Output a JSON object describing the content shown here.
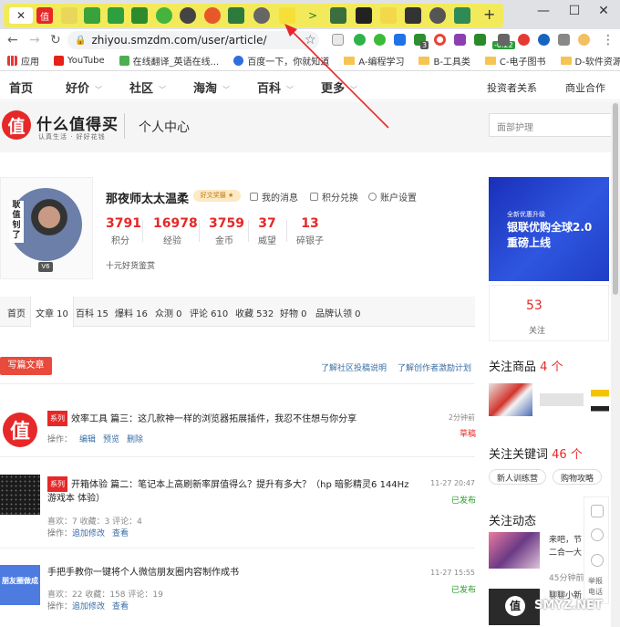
{
  "browser": {
    "tab_glyph": "✕",
    "new_tab": "+",
    "window_min": "—",
    "window_max": "☐",
    "window_close": "✕",
    "url": "zhiyou.smzdm.com/user/article/",
    "ext_badges": [
      "3",
      "-0.22"
    ]
  },
  "bookmarks": [
    {
      "label": "应用",
      "kind": "apps"
    },
    {
      "label": "YouTube",
      "kind": "youtube"
    },
    {
      "label": "在线翻译_英语在线...",
      "kind": "green"
    },
    {
      "label": "百度一下，你就知道",
      "kind": "paw"
    },
    {
      "label": "A-编程学习",
      "kind": "folder"
    },
    {
      "label": "B-工具类",
      "kind": "folder"
    },
    {
      "label": "C-电子图书",
      "kind": "folder"
    },
    {
      "label": "D-软件资源",
      "kind": "folder"
    }
  ],
  "sitenav": {
    "items": [
      "首页",
      "好价",
      "社区",
      "海淘",
      "百科",
      "更多"
    ],
    "right": [
      "投资者关系",
      "商业合作"
    ]
  },
  "header": {
    "logo_char": "值",
    "logo_text": "什么值得买",
    "slogan": "认真生活 · 好好花钱",
    "title": "个人中心",
    "search_placeholder": "面部护理"
  },
  "profile": {
    "avatar_text": "耿值钊了",
    "level": "V6",
    "username": "那夜师太太温柔",
    "badge": "好文奖摄 ★",
    "links": [
      "我的消息",
      "积分兑换",
      "账户设置"
    ],
    "stats": [
      {
        "value": "3791",
        "label": "积分"
      },
      {
        "value": "16978",
        "label": "经验"
      },
      {
        "value": "3759",
        "label": "金币"
      },
      {
        "value": "37",
        "label": "威望"
      },
      {
        "value": "13",
        "label": "碎银子"
      }
    ],
    "subtitle": "十元好货鉴赏"
  },
  "content_tabs": [
    "首页",
    "文章 10",
    "百科 15",
    "爆料 16",
    "众测 0",
    "评论 610",
    "收藏 532",
    "好物 0",
    "品牌认领 0"
  ],
  "actions": {
    "write": "写篇文章",
    "link1": "了解社区投稿说明",
    "link2": "了解创作者激励计划"
  },
  "articles": [
    {
      "tag": "系列",
      "title": "效率工具 篇三：这几款神一样的浏览器拓展插件，我忍不住想与你分享",
      "ops_label": "操作：",
      "ops": [
        "编辑",
        "预览",
        "删除"
      ],
      "time": "2分钟前",
      "status": "草稿"
    },
    {
      "tag": "系列",
      "title": "开箱体验 篇二：笔记本上高刷新率屏值得么？提升有多大？（hp 暗影精灵6 144Hz 游戏本 体验）",
      "meta": "喜欢：7   收藏：3   评论：4",
      "ops_label": "操作：",
      "ops": [
        "追加修改",
        "查看"
      ],
      "time": "11-27 20:47",
      "status": "已发布"
    },
    {
      "tag": "",
      "title": "手把手教你一键将个人微信朋友圈内容制作成书",
      "meta": "喜欢：22   收藏：158   评论：19",
      "ops_label": "操作：",
      "ops": [
        "追加修改",
        "查看"
      ],
      "thumb_text": "朋友圈做成",
      "time": "11-27 15:55",
      "status": "已发布"
    }
  ],
  "sidebar": {
    "banner": {
      "line1": "全新优惠升级",
      "line2": "银联优购全球2.0",
      "line3": "重磅上线"
    },
    "follow": {
      "value": "53",
      "label": "关注"
    },
    "goods": {
      "title": "关注商品",
      "count": "4 个"
    },
    "keywords": {
      "title": "关注关键词",
      "count": "46 个",
      "chips": [
        "新人训练营",
        "购物攻略"
      ]
    },
    "feed": {
      "title": "关注动态",
      "items": [
        {
          "text1": "来吧，节",
          "text2": "二合一大"
        },
        {
          "text1": "45分钟前",
          "text2": ""
        },
        {
          "text1": "聊聊小新",
          "text2": ""
        }
      ]
    },
    "float": [
      "举报",
      "电话"
    ]
  },
  "watermark": "SMYZ.NET",
  "colors": {
    "brand": "#e62828",
    "highlight": "#f2ea5a",
    "link": "#3a6ea5",
    "published": "#2a9a2a"
  }
}
